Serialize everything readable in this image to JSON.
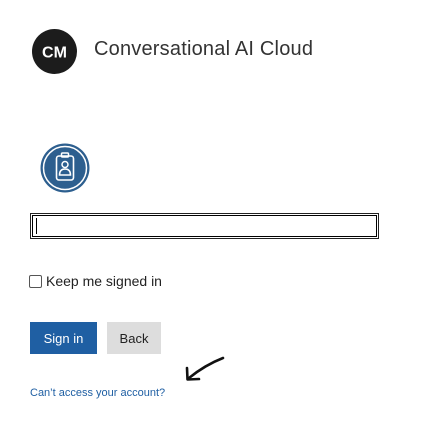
{
  "header": {
    "logo_icon": "cm-logo-icon",
    "logo_text": "CM",
    "brand_name": "Conversational AI Cloud"
  },
  "account_icon": "id-badge-icon",
  "input": {
    "value": "",
    "placeholder": ""
  },
  "keep_signed_in": {
    "label": "Keep me signed in",
    "checked": false
  },
  "buttons": {
    "sign_in": "Sign in",
    "back": "Back"
  },
  "annotation_icon": "arrow-pointer-icon",
  "links": {
    "cant_access": "Can’t access your account?"
  },
  "colors": {
    "primary": "#1f5fa3",
    "badge": "#2d5f8f",
    "logo": "#1c1c1c",
    "secondary_button": "#dddddd"
  }
}
